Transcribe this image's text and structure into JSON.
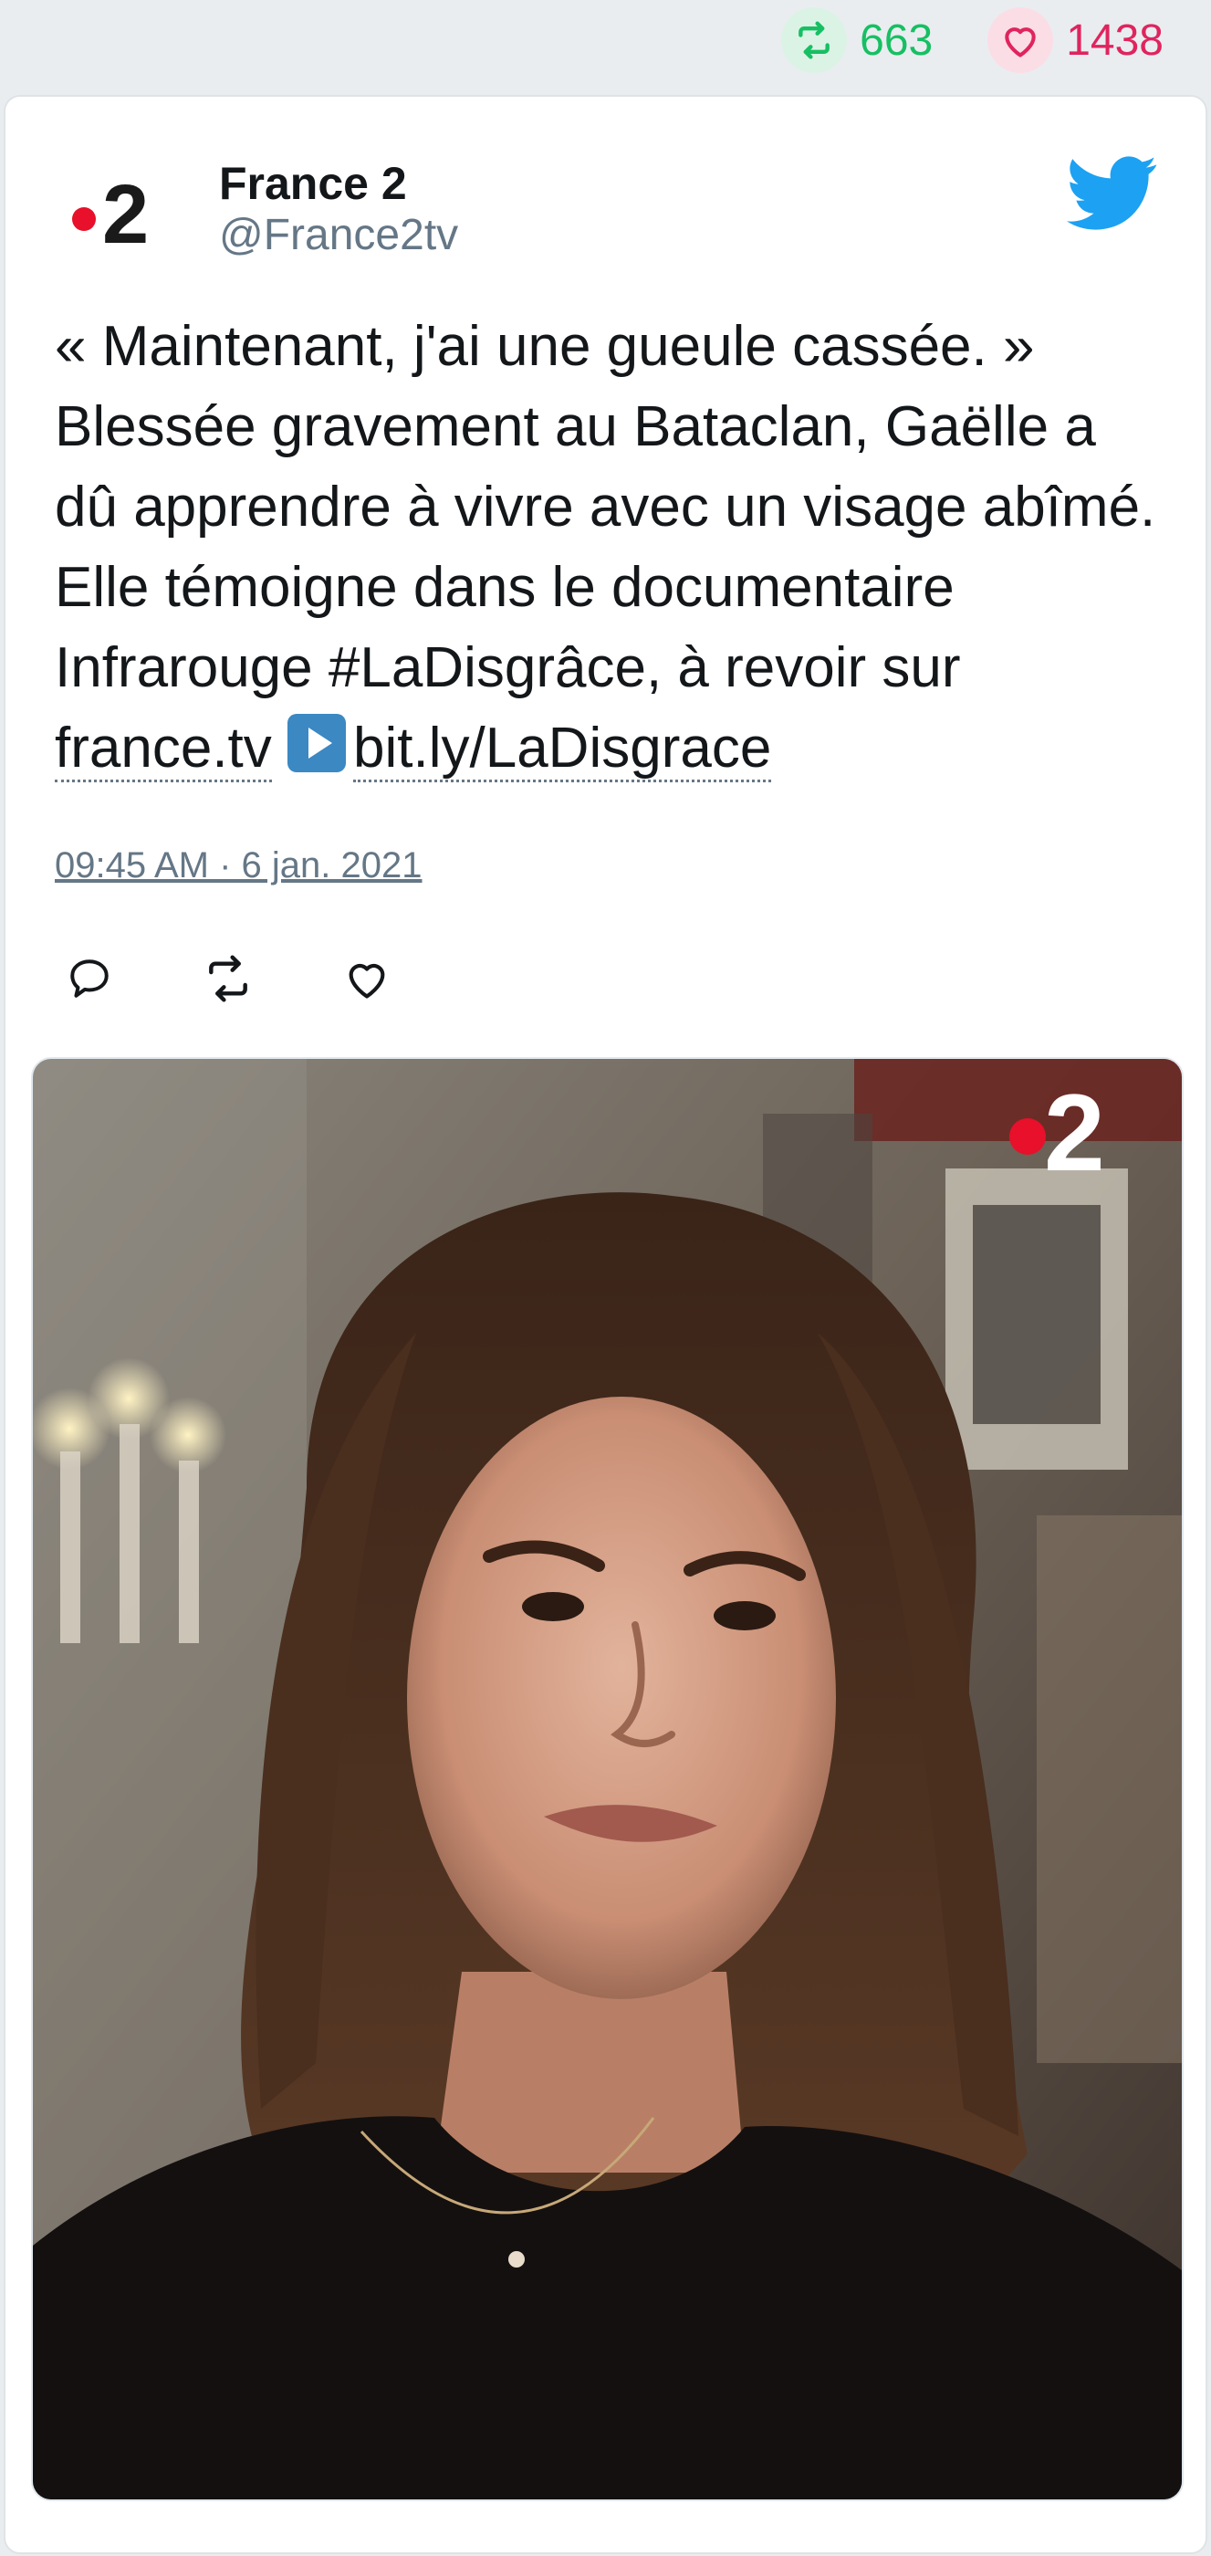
{
  "stats": {
    "retweet_count": "663",
    "like_count": "1438",
    "retweet_color": "#17bf63",
    "like_color": "#e0245e"
  },
  "author": {
    "name": "France 2",
    "handle": "@France2tv",
    "avatar_logo_text": "2",
    "avatar_icon": "france2-logo"
  },
  "tweet": {
    "text_part1": "« Maintenant, j'ai une gueule cassée. » Blessée gravement au Bataclan, Gaëlle a dû apprendre à vivre avec un visage abîmé. Elle témoigne dans le documentaire Infrarouge #LaDisgrâce, à revoir sur ",
    "link1": "france.tv",
    "play_icon": "play-button-emoji",
    "link2": "bit.ly/LaDisgrace",
    "timestamp": "09:45 AM · 6 jan. 2021"
  },
  "actions": [
    {
      "icon": "reply-icon"
    },
    {
      "icon": "retweet-icon"
    },
    {
      "icon": "like-icon"
    }
  ],
  "media": {
    "watermark_text": "2",
    "accent_red": "#e8102a",
    "brand_blue": "#1da1f2"
  }
}
